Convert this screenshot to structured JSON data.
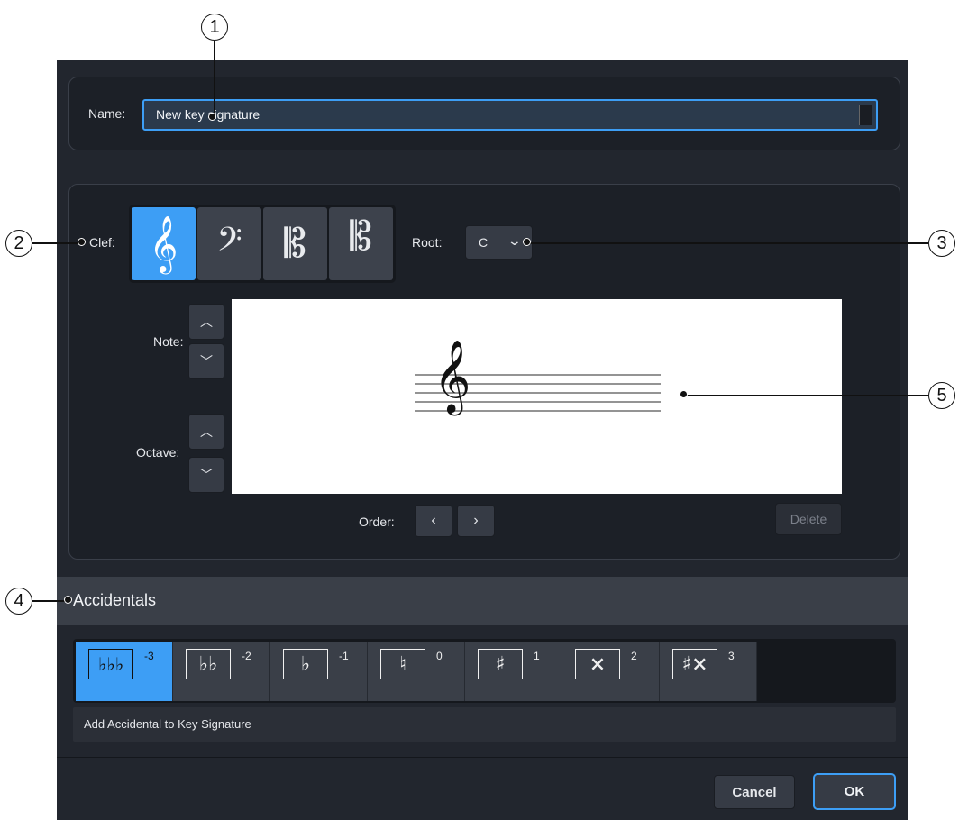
{
  "dialog": {
    "name_label": "Name:",
    "name_value": "New key signature",
    "clef_label": "Clef:",
    "clefs": [
      {
        "id": "treble",
        "glyph": "𝄞",
        "icon": "treble-clef-icon",
        "selected": true
      },
      {
        "id": "bass",
        "glyph": "𝄢",
        "icon": "bass-clef-icon",
        "selected": false
      },
      {
        "id": "alto",
        "glyph": "𝄡",
        "icon": "alto-clef-icon",
        "selected": false
      },
      {
        "id": "tenor",
        "glyph": "𝄡",
        "icon": "tenor-clef-icon",
        "selected": false
      }
    ],
    "root_label": "Root:",
    "root_value": "C",
    "note_label": "Note:",
    "octave_label": "Octave:",
    "order_label": "Order:",
    "delete_label": "Delete",
    "accidentals_header": "Accidentals",
    "accidentals": [
      {
        "glyph": "♭♭♭",
        "value": "-3",
        "selected": true
      },
      {
        "glyph": "♭♭",
        "value": "-2",
        "selected": false
      },
      {
        "glyph": "♭",
        "value": "-1",
        "selected": false
      },
      {
        "glyph": "♮",
        "value": "0",
        "selected": false
      },
      {
        "glyph": "♯",
        "value": "1",
        "selected": false
      },
      {
        "glyph": "×",
        "value": "2",
        "selected": false
      },
      {
        "glyph": "♯×",
        "value": "3",
        "selected": false
      }
    ],
    "add_accidental_label": "Add Accidental to Key Signature",
    "cancel_label": "Cancel",
    "ok_label": "OK"
  },
  "callouts": {
    "c1": "1",
    "c2": "2",
    "c3": "3",
    "c4": "4",
    "c5": "5"
  },
  "colors": {
    "accent": "#3d9ef5",
    "dialog_bg": "#22262e",
    "panel_bg": "#1c2027",
    "button_bg": "#363b45"
  }
}
